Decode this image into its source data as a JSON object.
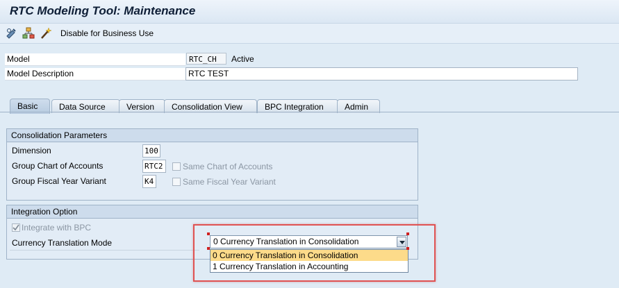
{
  "window": {
    "title": "RTC Modeling Tool: Maintenance"
  },
  "toolbar": {
    "icons": [
      "display-change-icon",
      "hierarchy-icon",
      "magic-wand-icon"
    ],
    "disable_label": "Disable for Business Use"
  },
  "header": {
    "model_label": "Model",
    "model_value": "RTC_CH",
    "model_status": "Active",
    "desc_label": "Model Description",
    "desc_value": "RTC TEST"
  },
  "tabs": [
    {
      "label": "Basic",
      "active": true
    },
    {
      "label": "Data Source"
    },
    {
      "label": "Version"
    },
    {
      "label": "Consolidation View"
    },
    {
      "label": "BPC Integration"
    },
    {
      "label": "Admin"
    }
  ],
  "consolidation": {
    "title": "Consolidation Parameters",
    "dimension_label": "Dimension",
    "dimension_value": "100",
    "gca_label": "Group Chart of Accounts",
    "gca_value": "RTC2",
    "same_coa_label": "Same Chart of Accounts",
    "fyv_label": "Group Fiscal Year Variant",
    "fyv_value": "K4",
    "same_fyv_label": "Same Fiscal Year Variant"
  },
  "integration": {
    "title": "Integration Option",
    "integrate_label": "Integrate with BPC",
    "integrate_checked": true,
    "ctm_label": "Currency Translation Mode",
    "ctm_selected": "0 Currency Translation in Consolidation",
    "options": [
      "0 Currency Translation in Consolidation",
      "1 Currency Translation in Accounting"
    ]
  },
  "colors": {
    "background": "#dfebf5",
    "selected_option": "#fddb8a",
    "highlight": "#e05252"
  }
}
